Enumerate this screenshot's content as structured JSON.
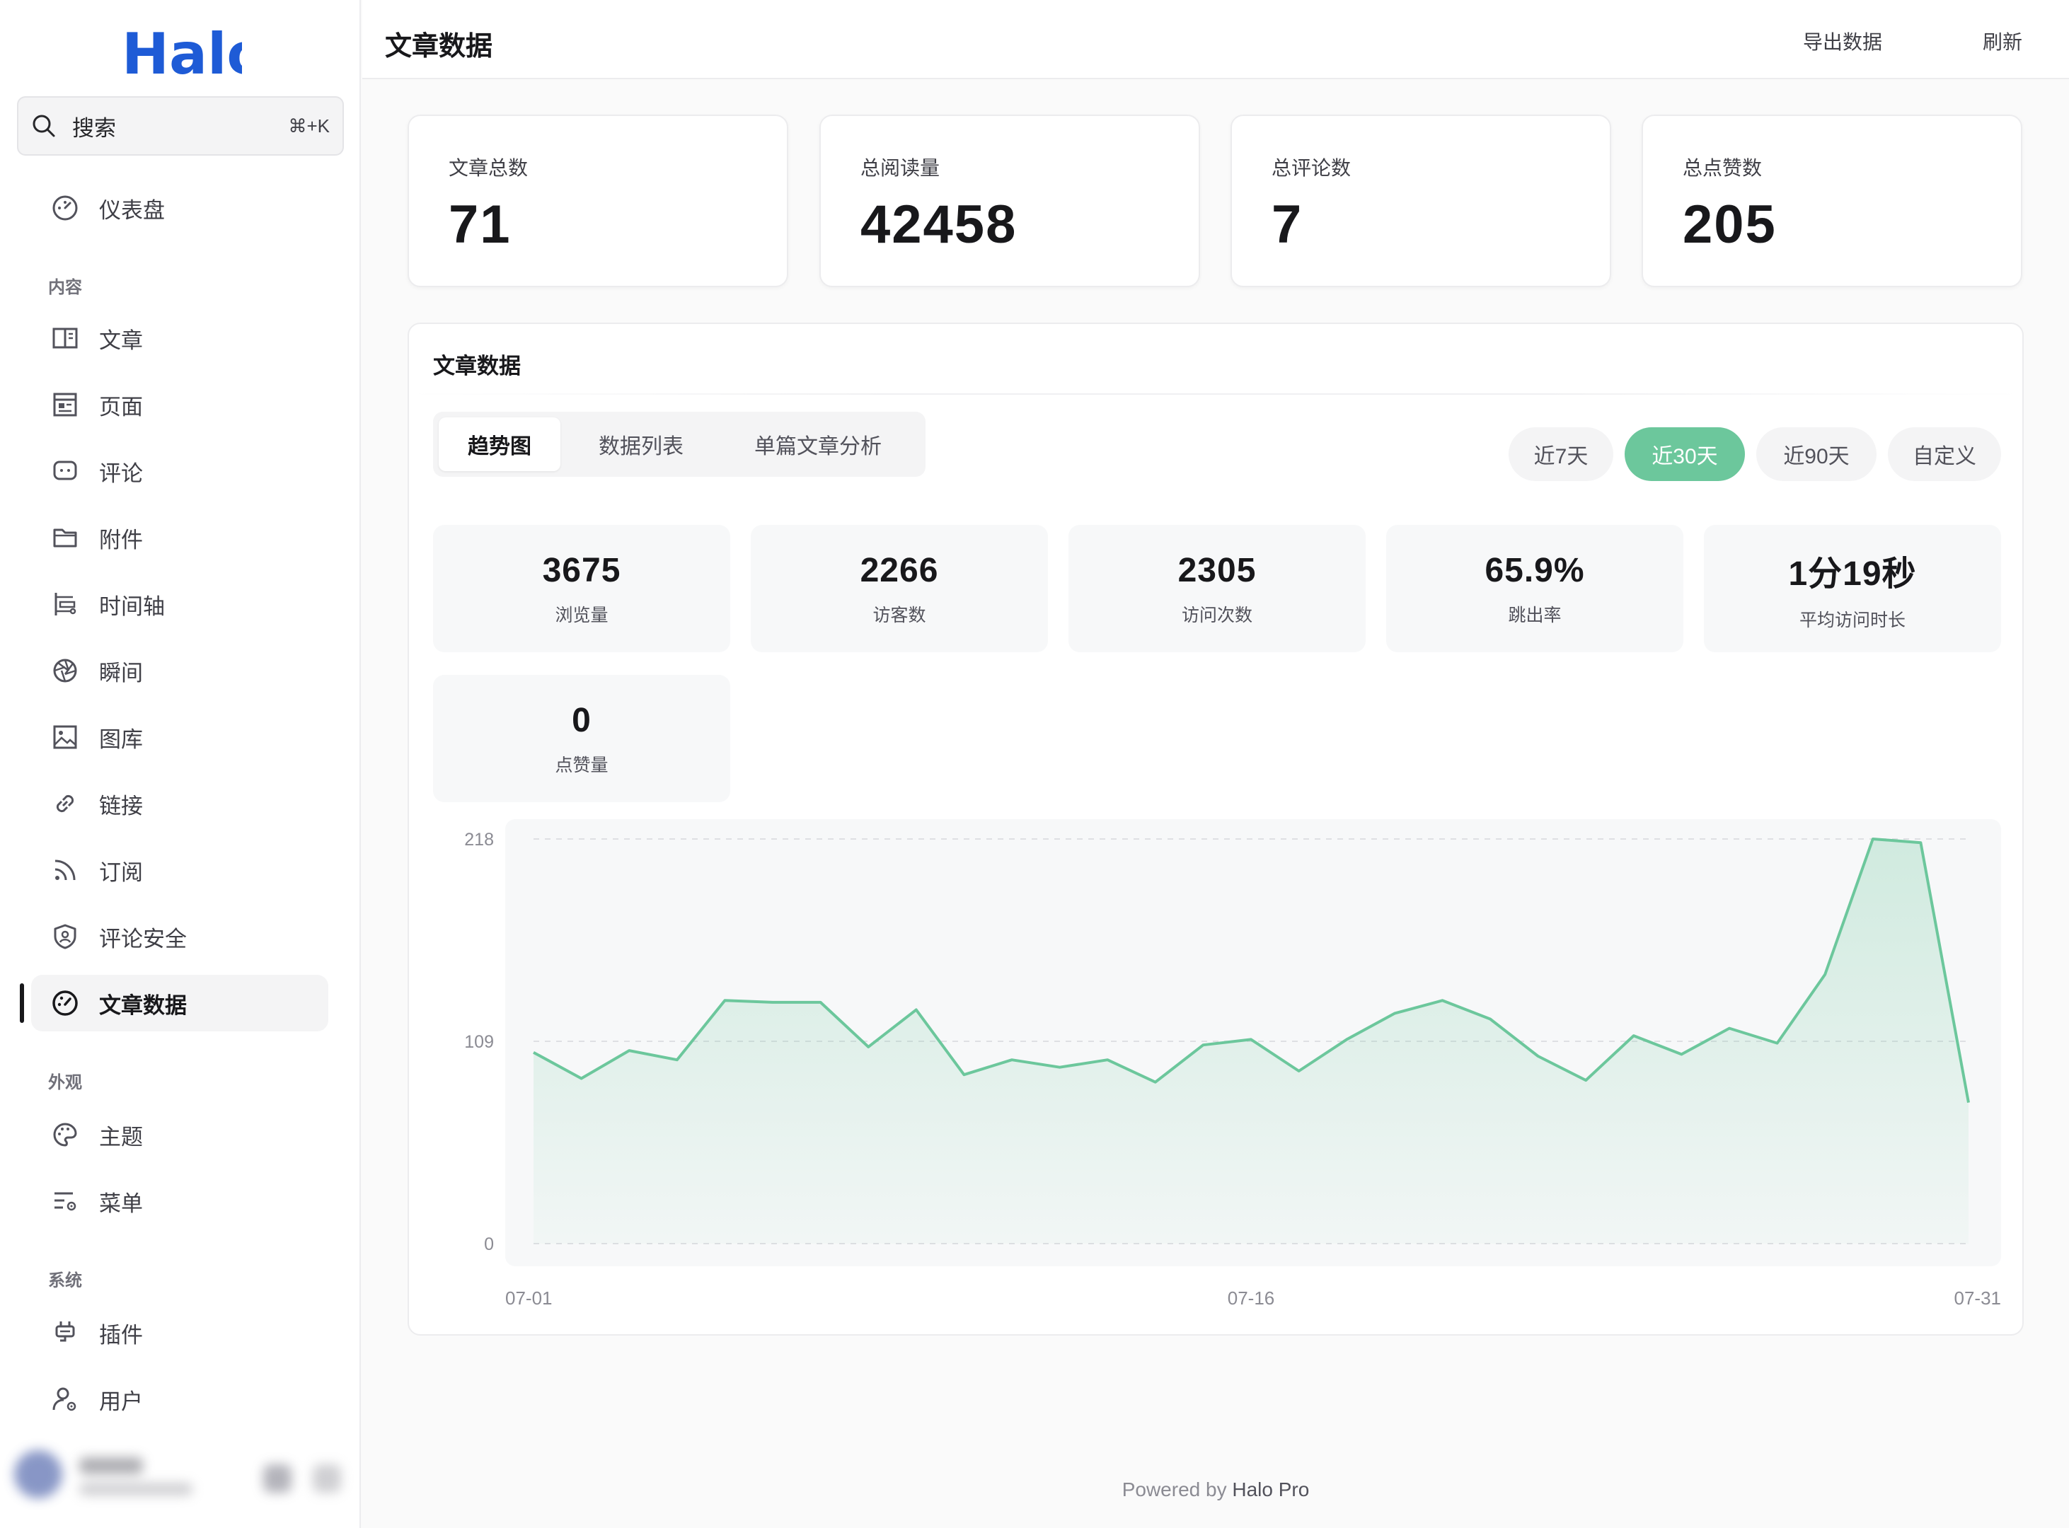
{
  "app": {
    "logo": "Halo"
  },
  "search": {
    "label": "搜索",
    "shortcut": "⌘+K"
  },
  "sidebar": {
    "dashboard": "仪表盘",
    "groups": {
      "content": "内容",
      "appearance": "外观",
      "system": "系统"
    },
    "items": {
      "posts": "文章",
      "pages": "页面",
      "comments": "评论",
      "attachments": "附件",
      "timeline": "时间轴",
      "moments": "瞬间",
      "gallery": "图库",
      "links": "链接",
      "subscribe": "订阅",
      "comment_security": "评论安全",
      "post_data": "文章数据",
      "themes": "主题",
      "menus": "菜单",
      "plugins": "插件",
      "users": "用户"
    }
  },
  "header": {
    "title": "文章数据",
    "export": "导出数据",
    "refresh": "刷新"
  },
  "stats": [
    {
      "label": "文章总数",
      "value": "71"
    },
    {
      "label": "总阅读量",
      "value": "42458"
    },
    {
      "label": "总评论数",
      "value": "7"
    },
    {
      "label": "总点赞数",
      "value": "205"
    }
  ],
  "panel": {
    "title": "文章数据",
    "tabs": [
      "趋势图",
      "数据列表",
      "单篇文章分析"
    ],
    "ranges": [
      "近7天",
      "近30天",
      "近90天",
      "自定义"
    ],
    "active_range": "近30天",
    "metrics": [
      {
        "value": "3675",
        "label": "浏览量"
      },
      {
        "value": "2266",
        "label": "访客数"
      },
      {
        "value": "2305",
        "label": "访问次数"
      },
      {
        "value": "65.9%",
        "label": "跳出率"
      },
      {
        "value": "1分19秒",
        "label": "平均访问时长"
      },
      {
        "value": "0",
        "label": "点赞量"
      }
    ]
  },
  "chart_data": {
    "type": "area",
    "x": [
      "07-01",
      "07-02",
      "07-03",
      "07-04",
      "07-05",
      "07-06",
      "07-07",
      "07-08",
      "07-09",
      "07-10",
      "07-11",
      "07-12",
      "07-13",
      "07-14",
      "07-15",
      "07-16",
      "07-17",
      "07-18",
      "07-19",
      "07-20",
      "07-21",
      "07-22",
      "07-23",
      "07-24",
      "07-25",
      "07-26",
      "07-27",
      "07-28",
      "07-29",
      "07-30",
      "07-31"
    ],
    "values": [
      103,
      89,
      104,
      99,
      131,
      130,
      130,
      106,
      126,
      91,
      99,
      95,
      99,
      87,
      107,
      110,
      93,
      110,
      124,
      131,
      121,
      101,
      88,
      112,
      102,
      116,
      108,
      145,
      218,
      216,
      76
    ],
    "x_ticks": [
      "07-01",
      "07-16",
      "07-31"
    ],
    "y_ticks": [
      "0",
      "109",
      "218"
    ],
    "ylim": [
      0,
      218
    ],
    "grid": true,
    "color": "#6cc79c"
  },
  "footer": {
    "text": "Powered by",
    "brand": "Halo Pro"
  }
}
